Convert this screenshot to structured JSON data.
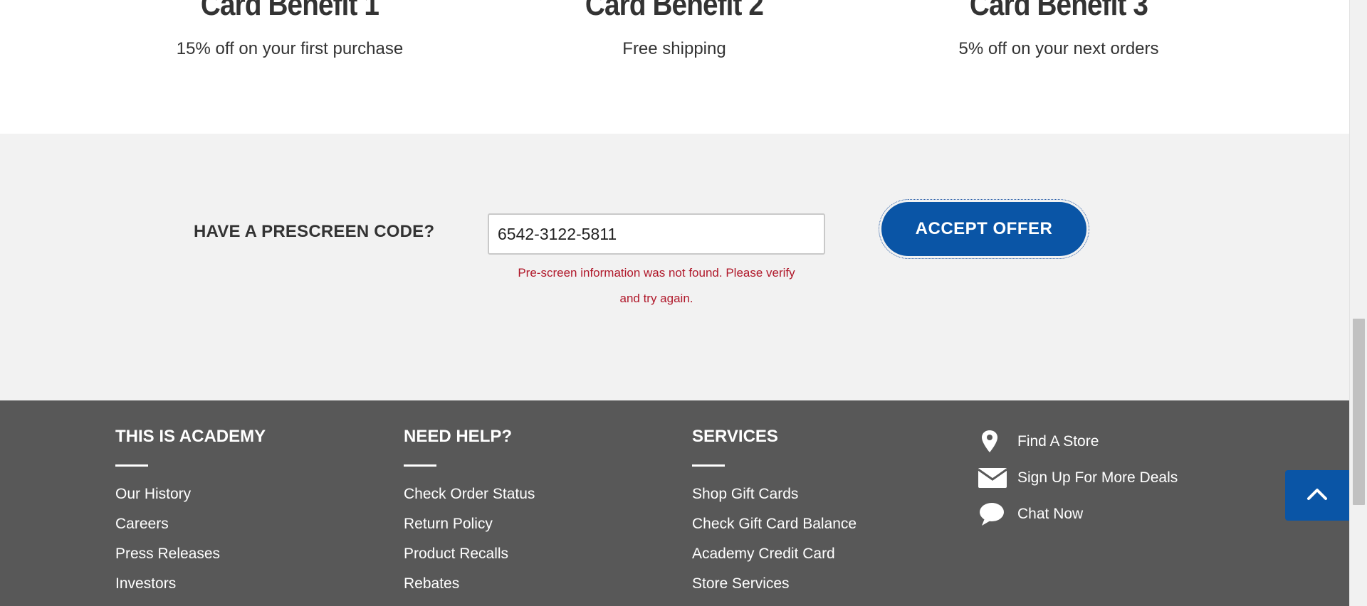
{
  "benefits": [
    {
      "title": "Card Benefit 1",
      "description": "15% off on your first purchase"
    },
    {
      "title": "Card Benefit 2",
      "description": "Free shipping"
    },
    {
      "title": "Card Benefit 3",
      "description": "5% off on your next orders"
    }
  ],
  "prescreen": {
    "label": "HAVE A PRESCREEN CODE?",
    "code_value": "6542-3122-5811",
    "error_line1": "Pre-screen information was not found. Please verify",
    "error_line2": "and try again.",
    "accept_label": "ACCEPT OFFER"
  },
  "footer": {
    "columns": [
      {
        "heading": "THIS IS ACADEMY",
        "links": [
          "Our History",
          "Careers",
          "Press Releases",
          "Investors"
        ]
      },
      {
        "heading": "NEED HELP?",
        "links": [
          "Check Order Status",
          "Return Policy",
          "Product Recalls",
          "Rebates"
        ]
      },
      {
        "heading": "SERVICES",
        "links": [
          "Shop Gift Cards",
          "Check Gift Card Balance",
          "Academy Credit Card",
          "Store Services"
        ]
      }
    ],
    "contact": [
      {
        "icon": "map-pin-icon",
        "label": "Find A Store"
      },
      {
        "icon": "envelope-icon",
        "label": "Sign Up For More Deals"
      },
      {
        "icon": "chat-bubble-icon",
        "label": "Chat Now"
      }
    ]
  },
  "colors": {
    "accent": "#0a55a6",
    "error": "#b0182a",
    "footer_bg": "#585858",
    "prescreen_bg": "#f2f2f2"
  }
}
